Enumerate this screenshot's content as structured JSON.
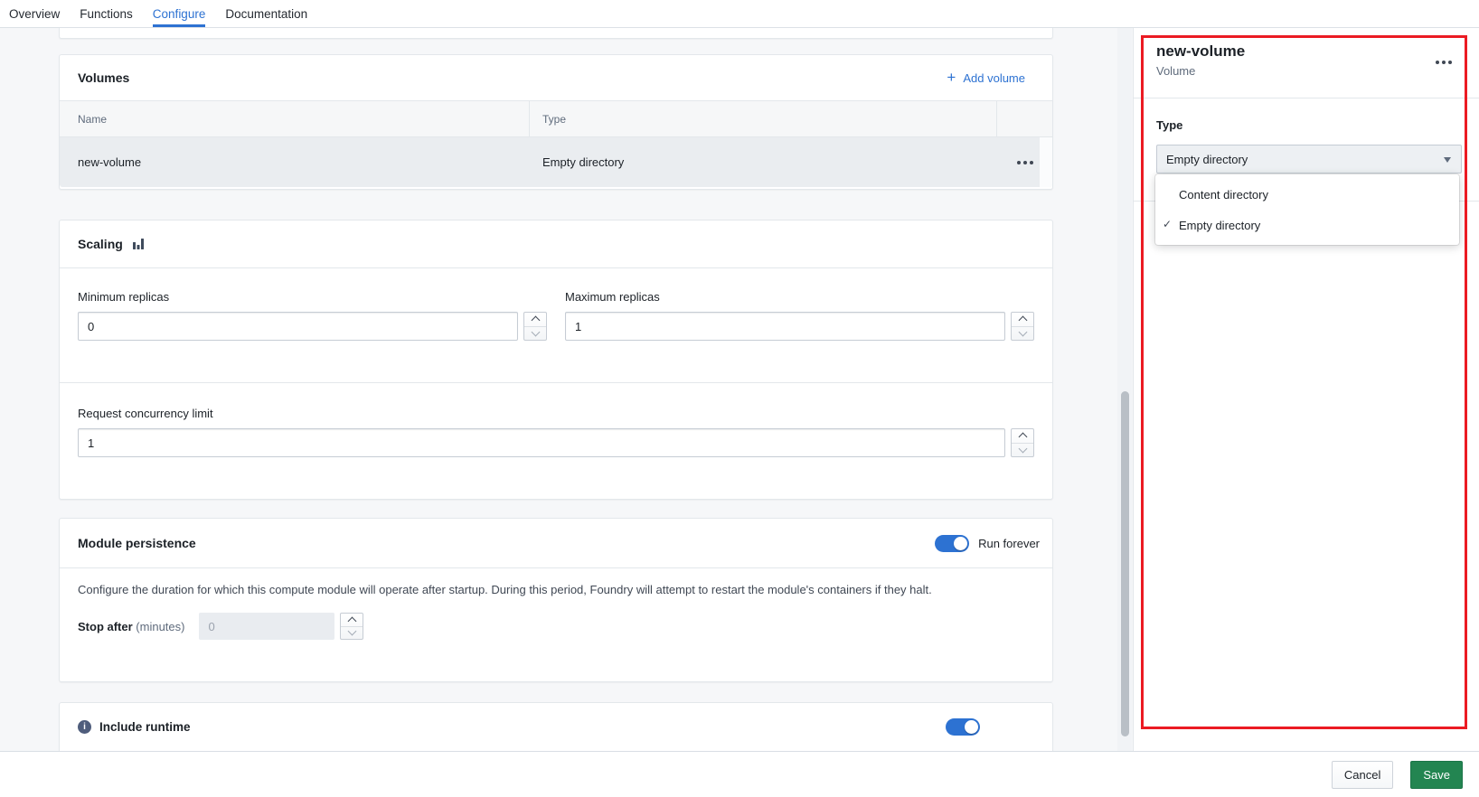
{
  "nav": {
    "tabs": [
      {
        "label": "Overview",
        "active": false
      },
      {
        "label": "Functions",
        "active": false
      },
      {
        "label": "Configure",
        "active": true
      },
      {
        "label": "Documentation",
        "active": false
      }
    ]
  },
  "volumes": {
    "title": "Volumes",
    "add_label": "Add volume",
    "columns": {
      "name": "Name",
      "type": "Type"
    },
    "rows": [
      {
        "name": "new-volume",
        "type": "Empty directory",
        "selected": true
      }
    ]
  },
  "scaling": {
    "title": "Scaling",
    "min_label": "Minimum replicas",
    "min_value": "0",
    "max_label": "Maximum replicas",
    "max_value": "1",
    "concurrency_label": "Request concurrency limit",
    "concurrency_value": "1"
  },
  "persistence": {
    "title": "Module persistence",
    "toggle_label": "Run forever",
    "toggle_on": true,
    "description": "Configure the duration for which this compute module will operate after startup. During this period, Foundry will attempt to restart the module's containers if they halt.",
    "stop_label": "Stop after",
    "stop_unit": "(minutes)",
    "stop_placeholder": "0",
    "stop_disabled": true
  },
  "runtime": {
    "title": "Include runtime",
    "toggle_on": true
  },
  "panel": {
    "title": "new-volume",
    "subtitle": "Volume",
    "type_label": "Type",
    "select_value": "Empty directory",
    "options": [
      {
        "label": "Content directory",
        "selected": false
      },
      {
        "label": "Empty directory",
        "selected": true
      }
    ],
    "check_glyph": "✓"
  },
  "footer": {
    "cancel_label": "Cancel",
    "save_label": "Save"
  },
  "icons": {
    "add": "plus-icon",
    "more": "three-dots-icon",
    "scaling": "bar-chart-icon",
    "info": "info-circle-icon",
    "select_caret": "caret-down-icon",
    "selected_check": "check-icon"
  },
  "colors": {
    "accent_blue": "#2D72D2",
    "save_green": "#238551",
    "annotation_red": "#EB1B23",
    "row_selected": "#EAEDF0"
  }
}
